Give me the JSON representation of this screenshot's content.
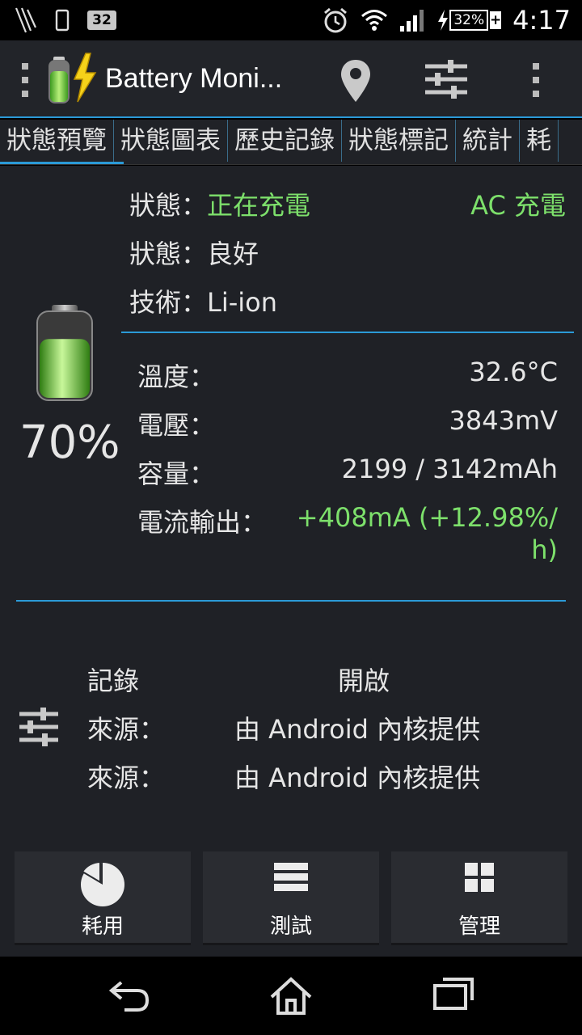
{
  "status_bar": {
    "badge": "32",
    "battery_percent": "32%",
    "time": "4:17",
    "icons": [
      "claw-icon",
      "phone-icon",
      "badge-icon",
      "alarm-icon",
      "wifi-icon",
      "signal-icon",
      "charging-icon",
      "battery-icon"
    ]
  },
  "action_bar": {
    "title": "Battery Moni...",
    "icons": [
      "app-icon",
      "location-pin-icon",
      "tune-icon",
      "overflow-menu-icon"
    ]
  },
  "tabs": [
    {
      "label": "狀態預覽"
    },
    {
      "label": "狀態圖表"
    },
    {
      "label": "歷史記錄"
    },
    {
      "label": "狀態標記"
    },
    {
      "label": "統計"
    },
    {
      "label": "耗"
    }
  ],
  "battery": {
    "percent_text": "70%",
    "level": 0.7
  },
  "info": {
    "status_label": "狀態：",
    "status_value": "正在充電",
    "charge_type": "AC 充電",
    "health_label": "狀態：",
    "health_value": "良好",
    "tech_label": "技術：",
    "tech_value": "Li-ion"
  },
  "metrics": {
    "temp_label": "溫度：",
    "temp_value": "32.6°C",
    "voltage_label": "電壓：",
    "voltage_value": "3843mV",
    "capacity_label": "容量：",
    "capacity_value": "2199 / 3142mAh",
    "current_label": "電流輸出：",
    "current_value_line1": "+408mA (+12.98%/",
    "current_value_line2": "h)"
  },
  "logging": {
    "record_label": "記錄",
    "record_value": "開啟",
    "source1_label": "來源：",
    "source1_value": "由 Android 內核提供",
    "source2_label": "來源：",
    "source2_value": "由 Android 內核提供"
  },
  "buttons": {
    "usage": "耗用",
    "test": "測試",
    "manage": "管理"
  },
  "colors": {
    "accent": "#2b9ad7",
    "green": "#7de06b",
    "background": "#1f2126"
  }
}
